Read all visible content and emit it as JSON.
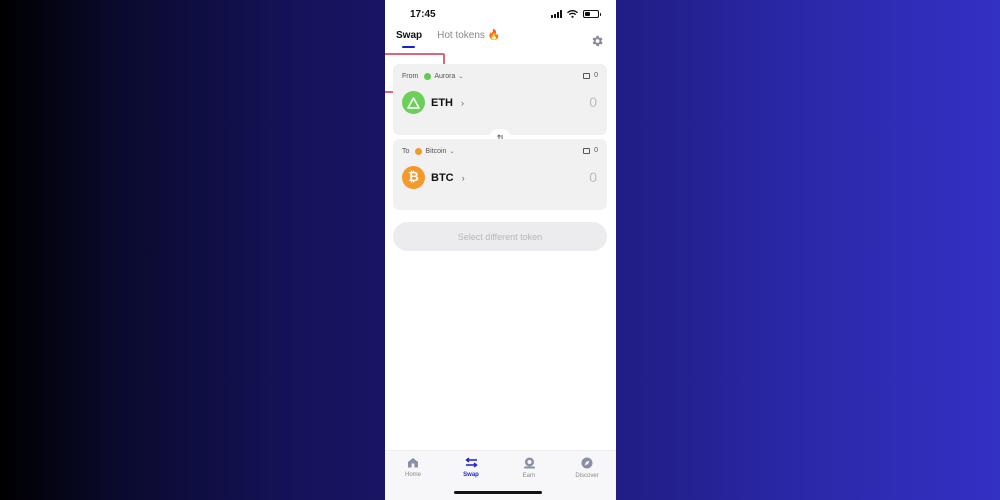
{
  "status_bar": {
    "time": "17:45"
  },
  "tabs": [
    {
      "label": "Swap",
      "active": true
    },
    {
      "label": "Hot tokens 🔥",
      "active": false
    }
  ],
  "from_card": {
    "direction_label": "From",
    "chain": "Aurora",
    "chain_color": "#5fcb4a",
    "balance": "0",
    "token": {
      "symbol": "ETH",
      "icon": "aurora-triangle-icon",
      "color": "#6ccf5a"
    },
    "amount": "0"
  },
  "to_card": {
    "direction_label": "To",
    "chain": "Bitcoin",
    "chain_color": "#f09a2c",
    "balance": "0",
    "token": {
      "symbol": "BTC",
      "icon": "bitcoin-icon",
      "color": "#f39a2b"
    },
    "amount": "0"
  },
  "action_button": {
    "label": "Select different token"
  },
  "bottom_nav": [
    {
      "label": "Home",
      "icon": "home-icon",
      "active": false
    },
    {
      "label": "Swap",
      "icon": "swap-arrows-icon",
      "active": true
    },
    {
      "label": "Earn",
      "icon": "earn-icon",
      "active": false
    },
    {
      "label": "Discover",
      "icon": "discover-icon",
      "active": false
    }
  ],
  "colors": {
    "accent": "#1a1fd0",
    "highlight": "#e06675"
  }
}
